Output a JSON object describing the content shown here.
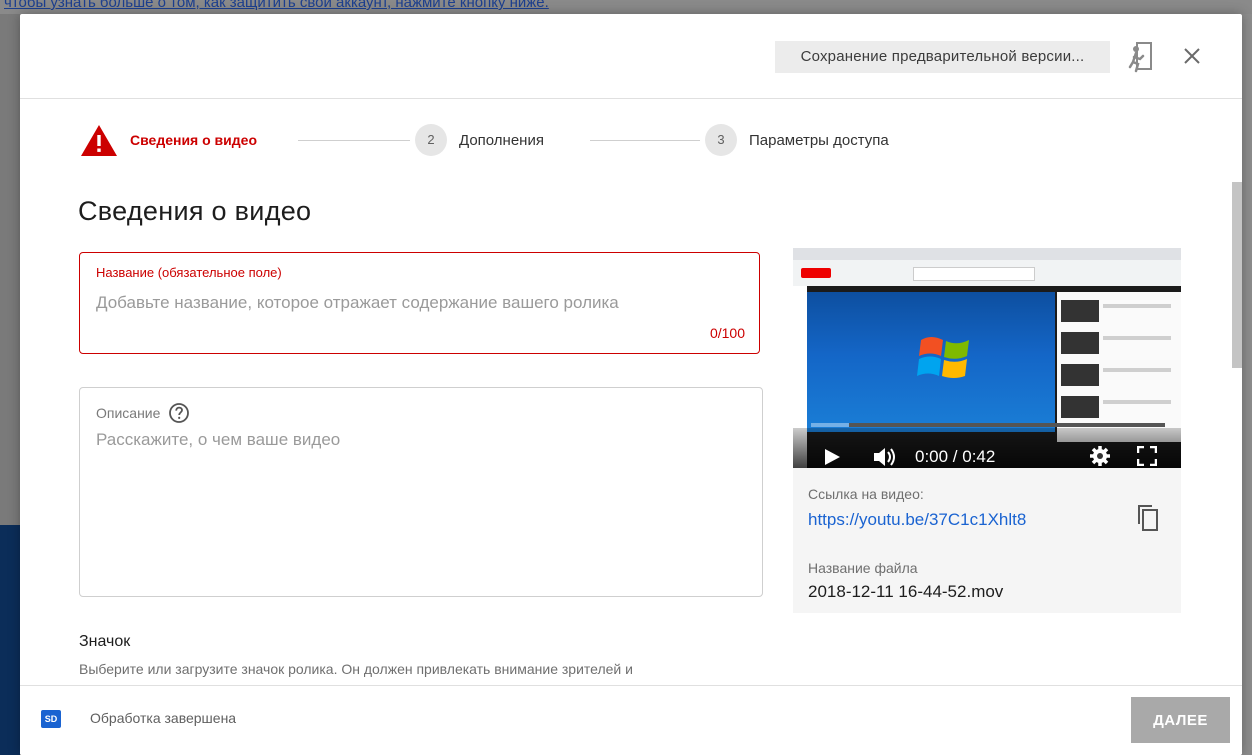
{
  "background": {
    "banner_text": "чтобы узнать больше о том, как защитить свой аккаунт, нажмите кнопку ниже."
  },
  "header": {
    "save_status": "Сохранение предварительной версии..."
  },
  "stepper": {
    "steps": [
      {
        "number": "",
        "label": "Сведения о видео",
        "state": "error"
      },
      {
        "number": "2",
        "label": "Дополнения"
      },
      {
        "number": "3",
        "label": "Параметры доступа"
      }
    ]
  },
  "main": {
    "title": "Сведения о видео",
    "title_field": {
      "label": "Название (обязательное поле)",
      "placeholder": "Добавьте название, которое отражает содержание вашего ролика",
      "counter": "0/100"
    },
    "description_field": {
      "label": "Описание",
      "placeholder": "Расскажите, о чем ваше видео"
    },
    "thumbnail": {
      "heading": "Значок",
      "description": "Выберите или загрузите значок ролика. Он должен привлекать внимание зрителей и"
    }
  },
  "preview": {
    "time": "0:00 / 0:42",
    "link_label": "Ссылка на видео:",
    "link": "https://youtu.be/37C1c1Xhlt8",
    "filename_label": "Название файла",
    "filename": "2018-12-11 16-44-52.mov"
  },
  "footer": {
    "sd_badge": "SD",
    "status": "Обработка завершена",
    "next_label": "ДАЛЕЕ"
  },
  "colors": {
    "error": "#cc0000",
    "link": "#1a63d1",
    "next_button": "#a9a9a9"
  }
}
